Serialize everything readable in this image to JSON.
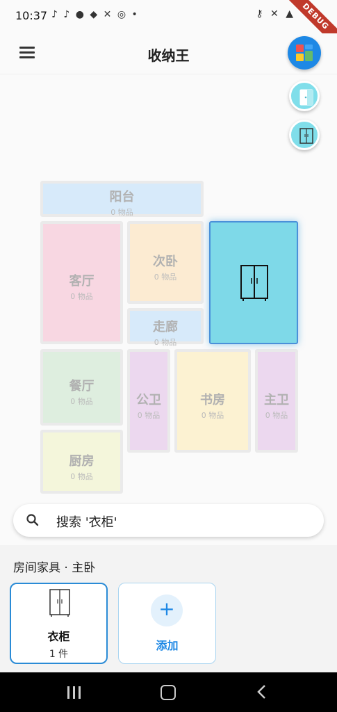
{
  "status_bar": {
    "time": "10:37",
    "left_icons": "♪ ♪ ● ◆ ✕ ◎ •",
    "right_icons": "⚷ ✕ ▲",
    "debug_label": "DEBUG"
  },
  "app_bar": {
    "title": "收纳王",
    "menu_icon": "menu-icon",
    "fab_icon": "dashboard-icon"
  },
  "side_actions": [
    {
      "icon": "door-icon"
    },
    {
      "icon": "wardrobe-icon"
    }
  ],
  "rooms": [
    {
      "name": "阳台",
      "count": "0 物品",
      "color": "#bbdefb"
    },
    {
      "name": "客厅",
      "count": "0 物品",
      "color": "#f8bbd0"
    },
    {
      "name": "次卧",
      "count": "0 物品",
      "color": "#ffe0b2"
    },
    {
      "name": "走廊",
      "count": "0 物品",
      "color": "#bbdefb"
    },
    {
      "name": "主卧",
      "count": "",
      "color": "#7ed9e8",
      "selected": true
    },
    {
      "name": "餐厅",
      "count": "0 物品",
      "color": "#c8e6c9"
    },
    {
      "name": "公卫",
      "count": "0 物品",
      "color": "#e1bee7"
    },
    {
      "name": "书房",
      "count": "0 物品",
      "color": "#ffecb3"
    },
    {
      "name": "主卫",
      "count": "0 物品",
      "color": "#e1bee7"
    },
    {
      "name": "厨房",
      "count": "0 物品",
      "color": "#f0f4c3"
    }
  ],
  "search": {
    "text": "搜索 '衣柜'",
    "icon": "search-icon"
  },
  "furniture_panel": {
    "title": "房间家具 · 主卧",
    "items": [
      {
        "name": "衣柜",
        "count": "1 件",
        "icon": "wardrobe-icon"
      }
    ],
    "add_label": "添加",
    "add_symbol": "+"
  },
  "colors": {
    "accent": "#1e88e5",
    "selected_room": "#7ed9e8",
    "selected_border": "#4a90d9"
  }
}
